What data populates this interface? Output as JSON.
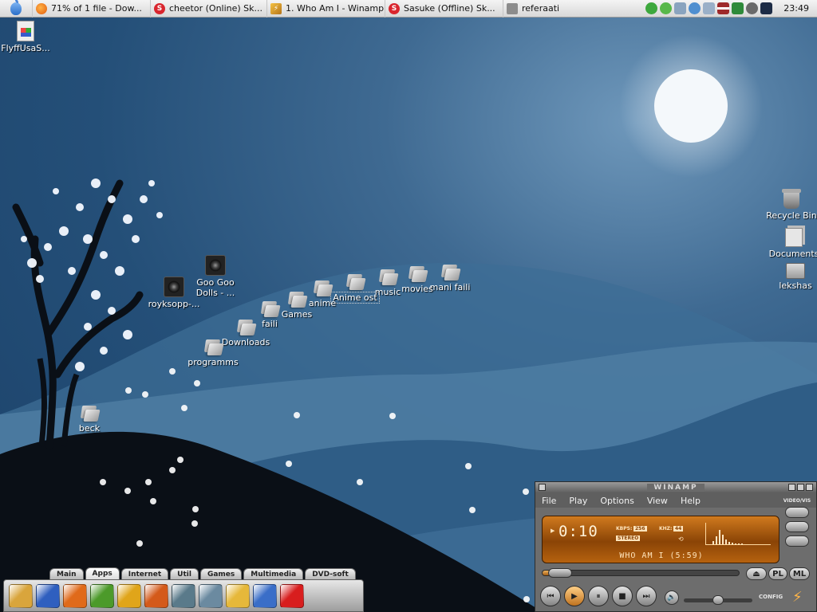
{
  "taskbar": {
    "tasks": [
      {
        "label": "71% of 1 file - Dow...",
        "icon": "firefox-icon"
      },
      {
        "label": "cheetor (Online) Sk...",
        "icon": "skype-icon"
      },
      {
        "label": "1. Who Am I - Winamp",
        "icon": "winamp-icon"
      },
      {
        "label": "Sasuke (Offline) Sk...",
        "icon": "skype-icon"
      },
      {
        "label": "referaati",
        "icon": "folder-icon"
      }
    ],
    "tray_icons": [
      "utorrent-icon",
      "check-shield-icon",
      "network-icon",
      "sync-icon",
      "disk-icon",
      "flag-latvia-icon",
      "power-icon",
      "speaker-icon",
      "steam-icon"
    ],
    "clock": "23:49"
  },
  "desktop": {
    "icons": [
      {
        "label": "FlyffUsaS...",
        "type": "app"
      },
      {
        "label": "Goo Goo",
        "label2": "Dolls - ...",
        "type": "audio"
      },
      {
        "label": "royksopp-...",
        "type": "audio"
      },
      {
        "label": "mani faili",
        "type": "folder"
      },
      {
        "label": "movies",
        "type": "folder"
      },
      {
        "label": "music",
        "type": "folder"
      },
      {
        "label": "Anime ost",
        "type": "folder",
        "selected": true
      },
      {
        "label": "anime",
        "type": "folder"
      },
      {
        "label": "Games",
        "type": "folder"
      },
      {
        "label": "faili",
        "type": "folder"
      },
      {
        "label": "Downloads",
        "type": "folder"
      },
      {
        "label": "programms",
        "type": "folder"
      },
      {
        "label": "beck",
        "type": "folder"
      },
      {
        "label": "Recycle Bin",
        "type": "bin"
      },
      {
        "label": "Documents",
        "type": "docs"
      },
      {
        "label": "lekshas",
        "type": "computer"
      }
    ]
  },
  "winamp": {
    "title": "WINAMP",
    "menu": [
      "File",
      "Play",
      "Options",
      "View",
      "Help"
    ],
    "time": "0:10",
    "kbps_label": "KBPS:",
    "kbps": "256",
    "khz_label": "KHZ:",
    "khz": "44",
    "stereo": "STEREO",
    "song": "WHO AM I (5:59)",
    "side_label": "VIDEO/VIS",
    "pl": "PL",
    "ml": "ML",
    "config": "CONFIG",
    "progress_fraction": 0.03,
    "volume_fraction": 0.5
  },
  "dock": {
    "tabs": [
      {
        "label": "Main",
        "active": false
      },
      {
        "label": "Apps",
        "active": true
      },
      {
        "label": "Internet",
        "active": false
      },
      {
        "label": "Util",
        "active": false
      },
      {
        "label": "Games",
        "active": false
      },
      {
        "label": "Multimedia",
        "active": false
      },
      {
        "label": "DVD-soft",
        "active": false
      }
    ],
    "items": [
      {
        "icon": "paint-brushes-icon",
        "color": "#d9a53c"
      },
      {
        "icon": "word-icon",
        "color": "#2f5fbf"
      },
      {
        "icon": "office-orange-icon",
        "color": "#e06a1a"
      },
      {
        "icon": "excel-icon",
        "color": "#4c9a2a"
      },
      {
        "icon": "office-yellow-icon",
        "color": "#e0a51a"
      },
      {
        "icon": "powerpoint-icon",
        "color": "#d45a1a"
      },
      {
        "icon": "math-sigma-icon",
        "color": "#5a7a8a"
      },
      {
        "icon": "table-icon",
        "color": "#6b8aa0"
      },
      {
        "icon": "pencil-edit-icon",
        "color": "#e6b83a"
      },
      {
        "icon": "photo-viewer-icon",
        "color": "#3a6ec8"
      },
      {
        "icon": "red-splat-icon",
        "color": "#d81e1e"
      }
    ]
  }
}
